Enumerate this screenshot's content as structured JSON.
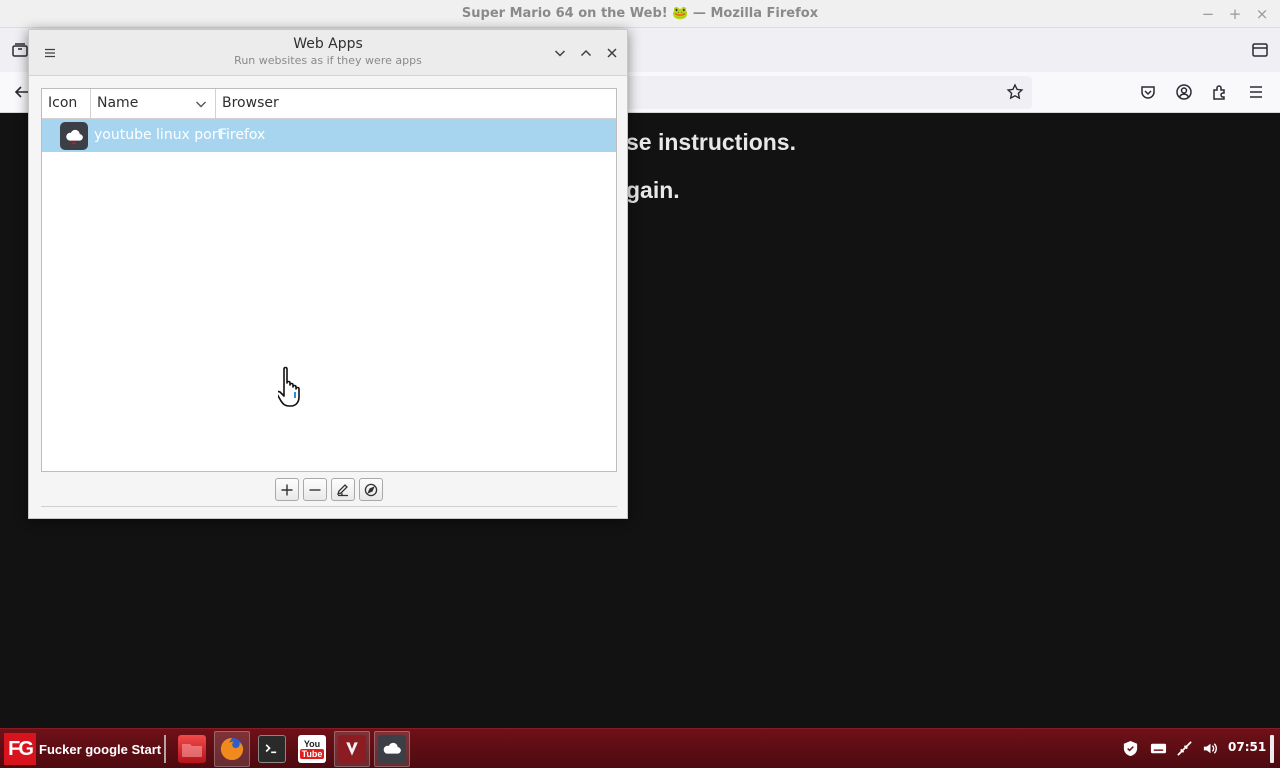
{
  "firefox": {
    "window_title": "Super Mario 64 on the Web! 🐸 — Mozilla Firefox",
    "content_line1": "se instructions.",
    "content_line2": "gain."
  },
  "webapps": {
    "title": "Web Apps",
    "subtitle": "Run websites as if they were apps",
    "columns": {
      "icon": "Icon",
      "name": "Name",
      "browser": "Browser"
    },
    "rows": [
      {
        "icon": "cloud-app-icon",
        "name": "youtube linux port",
        "browser": "Firefox",
        "selected": true
      }
    ],
    "toolbar": [
      "add-icon",
      "remove-icon",
      "edit-icon",
      "run-icon"
    ]
  },
  "taskbar": {
    "start_label": "Fucker google Start",
    "start_logo": "FG",
    "launchers": [
      "file-manager-icon",
      "firefox-icon",
      "terminal-icon",
      "youtube-icon",
      "vivaldi-icon",
      "webapps-icon"
    ],
    "clock": "07:51",
    "accent": "#d7141d"
  }
}
